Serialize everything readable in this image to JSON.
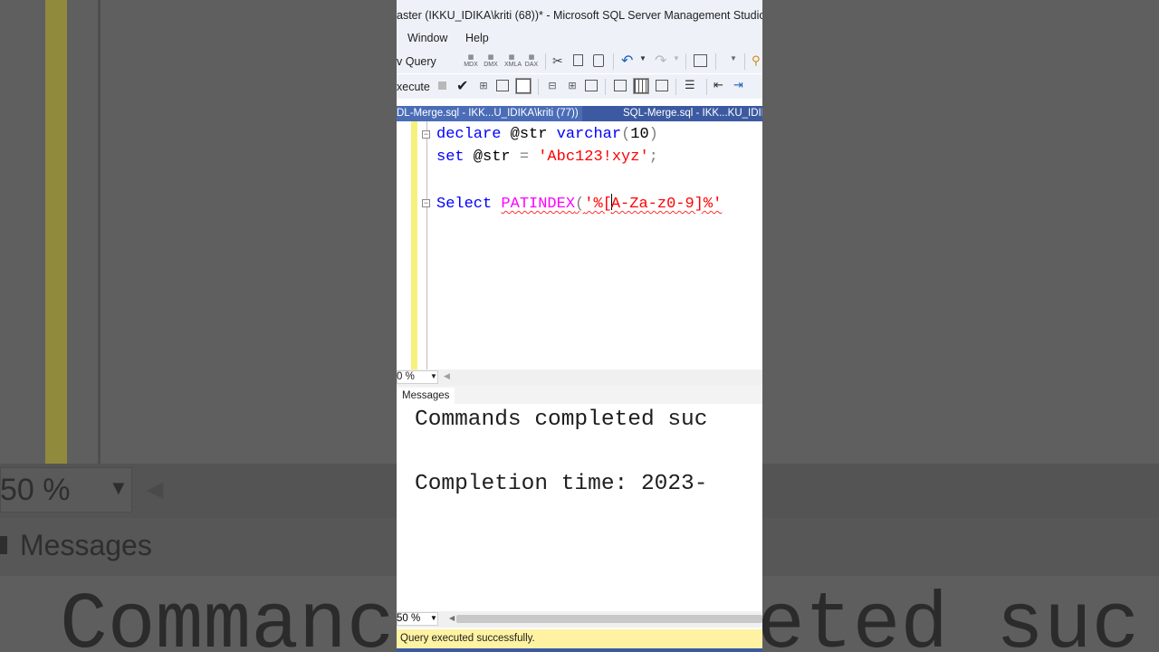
{
  "window": {
    "title": "aster (IKKU_IDIKA\\kriti (68))* - Microsoft SQL Server Management Studio"
  },
  "menu": {
    "window": "Window",
    "help": "Help"
  },
  "toolbar": {
    "new_query": "v Query",
    "execute": "xecute"
  },
  "doc_tabs": [
    {
      "label": "DL-Merge.sql - IKK...U_IDIKA\\kriti (77))"
    },
    {
      "label": "SQL-Merge.sql - IKK...KU_IDIK"
    }
  ],
  "editor": {
    "line1": {
      "kw1": "declare",
      "var": " @str ",
      "kw2": "varchar",
      "p1": "(",
      "num": "10",
      "p2": ")"
    },
    "line2": {
      "kw": "set",
      "var": " @str ",
      "eq": "=",
      "str": " 'Abc123!xyz'",
      "semi": ";"
    },
    "line3": {
      "kw": "Select",
      "fn": "PATINDEX",
      "paren": "(",
      "str_a": "'%[",
      "str_b": "A-Za-z0-9]%'"
    },
    "zoom": "0 %"
  },
  "results": {
    "tab": "Messages",
    "line1": "Commands completed suc",
    "line2": "Completion time: 2023-",
    "zoom": "50 %"
  },
  "status": {
    "text": "Query executed successfully."
  },
  "background": {
    "zoom": "50 %",
    "messages": "Messages",
    "big_left": "Commanc",
    "big_right": "eted suc"
  },
  "colors": {
    "keyword": "#0000ff",
    "function": "#ff00ff",
    "string": "#ff0000",
    "tab_active": "#4b6db8",
    "status_bar": "#fff3a3"
  }
}
